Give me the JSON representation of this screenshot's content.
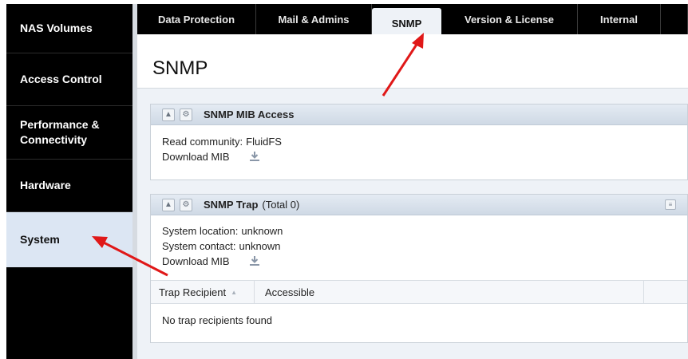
{
  "sidebar": {
    "items": [
      {
        "label": "NAS Volumes"
      },
      {
        "label": "Access Control"
      },
      {
        "label": "Performance & Connectivity"
      },
      {
        "label": "Hardware"
      },
      {
        "label": "System",
        "active": true
      }
    ]
  },
  "tabs": [
    {
      "label": "Data Protection"
    },
    {
      "label": "Mail & Admins"
    },
    {
      "label": "SNMP",
      "active": true
    },
    {
      "label": "Version & License"
    },
    {
      "label": "Internal"
    },
    {
      "label": ""
    }
  ],
  "page": {
    "title": "SNMP"
  },
  "mib_panel": {
    "title": "SNMP MIB Access",
    "read_community_label": "Read community:",
    "read_community_value": "FluidFS",
    "download_label": "Download MIB"
  },
  "trap_panel": {
    "title": "SNMP Trap",
    "total": "(Total  0)",
    "location_label": "System location:",
    "location_value": "unknown",
    "contact_label": "System contact:",
    "contact_value": "unknown",
    "download_label": "Download MIB",
    "columns": [
      "Trap Recipient",
      "Accessible",
      ""
    ],
    "empty_message": "No trap recipients found"
  },
  "colors": {
    "annotation_arrow": "#e01818",
    "sidebar_bg": "#000000",
    "active_bg": "#dce6f3"
  },
  "icons": [
    "collapse-icon",
    "settings-icon",
    "download-icon",
    "panel-options-icon",
    "sort-arrow-icon"
  ]
}
